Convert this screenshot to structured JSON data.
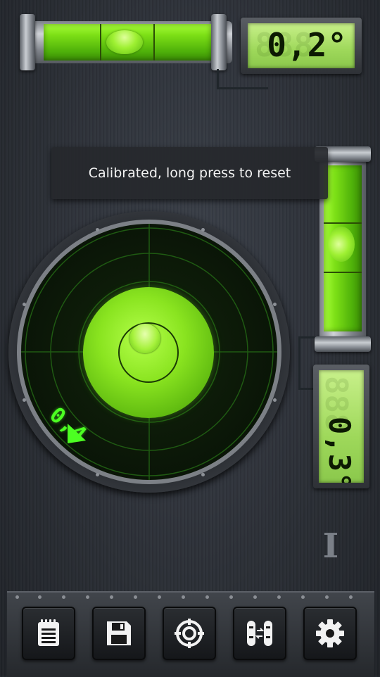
{
  "level": {
    "horizontal_angle_text": "0,2°",
    "vertical_angle_text": "0,3°",
    "bullseye_angle_text": "0,4"
  },
  "toast": {
    "message": "Calibrated, long press to reset"
  },
  "side_button": {
    "glyph": "I"
  },
  "toolbar": {
    "buttons": [
      {
        "name": "notes",
        "icon": "notepad-icon"
      },
      {
        "name": "save",
        "icon": "floppy-disk-icon"
      },
      {
        "name": "calibrate",
        "icon": "target-icon"
      },
      {
        "name": "switch-mode",
        "icon": "level-switch-icon"
      },
      {
        "name": "settings",
        "icon": "gear-icon"
      }
    ]
  },
  "colors": {
    "bubble_green": "#8ae420",
    "lcd_green": "#9ed85a",
    "readout_green": "#4cff22",
    "metal_dark": "#2b2f36"
  }
}
